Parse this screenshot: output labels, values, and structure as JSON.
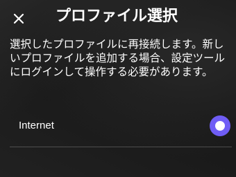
{
  "header": {
    "close_icon": "close-icon",
    "title": "プロファイル選択"
  },
  "description": "選択したプロファイルに再接続します。新しいプロファイルを追加する場合、設定ツールにログインして操作する必要があります。",
  "profiles": [
    {
      "label": "Internet",
      "selected": true
    }
  ],
  "colors": {
    "accent": "#6f5df5",
    "text": "#ffffff",
    "background": "#181818"
  }
}
